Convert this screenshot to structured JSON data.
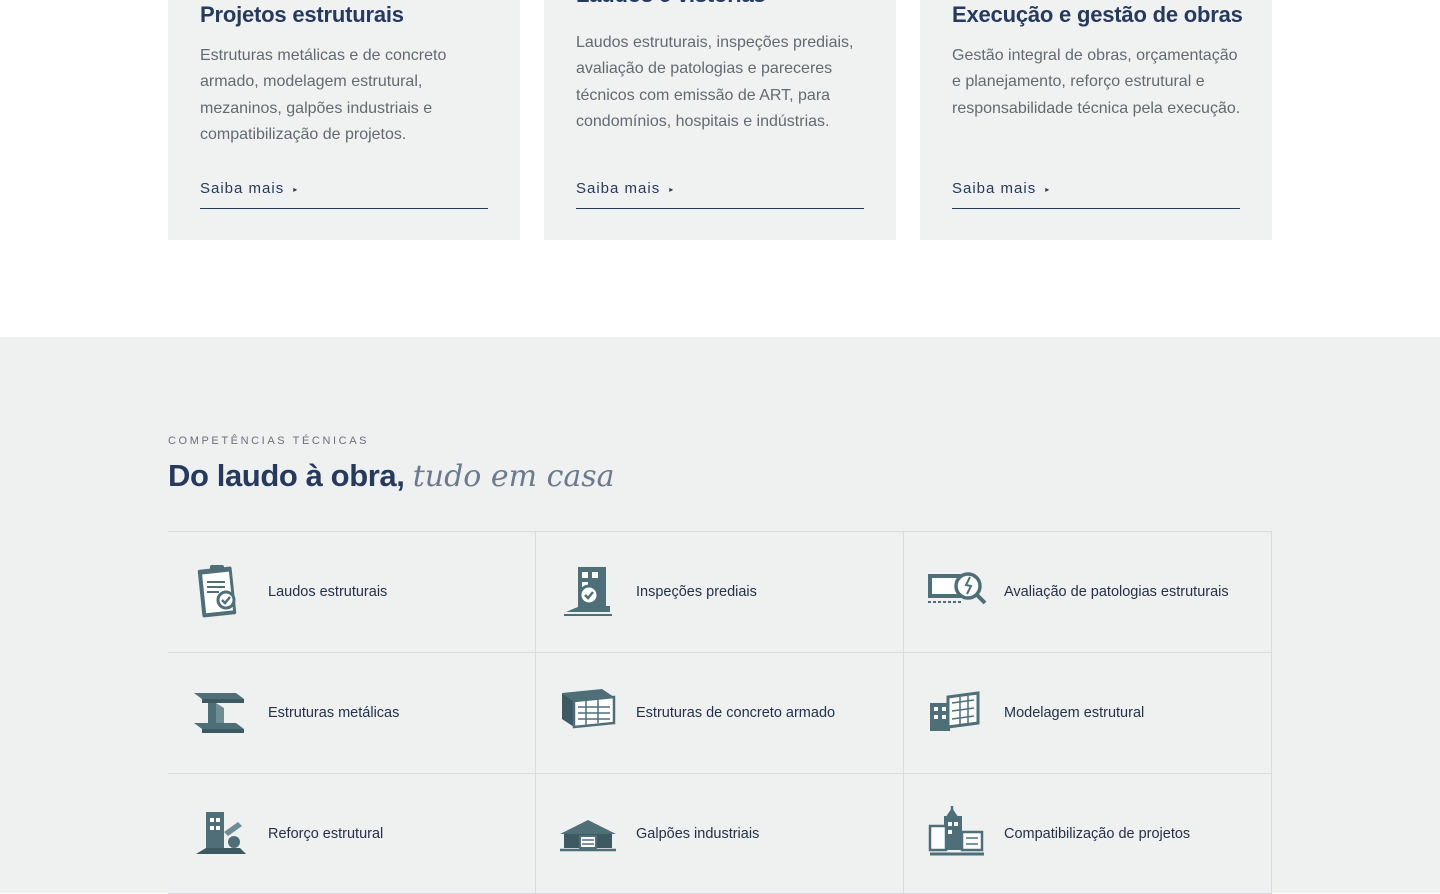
{
  "service_cards": [
    {
      "title": "Projetos estruturais",
      "description": "Estruturas metálicas e de concreto armado, modelagem estrutural, mezaninos, galpões industriais e compatibilização de projetos.",
      "link": "Saiba mais"
    },
    {
      "title": "Laudos e vistorias",
      "description": "Laudos estruturais, inspeções prediais, avaliação de patologias e pareceres técnicos com emissão de ART, para condomínios, hospitais e indústrias.",
      "link": "Saiba mais"
    },
    {
      "title": "Execução e gestão de obras",
      "description": "Gestão integral de obras, orçamentação e planejamento, reforço estrutural e responsabilidade técnica pela execução.",
      "link": "Saiba mais"
    }
  ],
  "link_arrow": "▸",
  "competencias": {
    "eyebrow": "COMPETÊNCIAS TÉCNICAS",
    "headline_bold": "Do laudo à obra,",
    "headline_italic": "tudo em casa",
    "items": [
      {
        "label": "Laudos estruturais",
        "icon": "clipboard-check-icon"
      },
      {
        "label": "Inspeções prediais",
        "icon": "building-inspection-icon"
      },
      {
        "label": "Avaliação de patologias estruturais",
        "icon": "magnifier-crack-icon"
      },
      {
        "label": "Estruturas metálicas",
        "icon": "steel-beam-icon"
      },
      {
        "label": "Estruturas de concreto armado",
        "icon": "concrete-rebar-icon"
      },
      {
        "label": "Modelagem estrutural",
        "icon": "structural-model-icon"
      },
      {
        "label": "Reforço estrutural",
        "icon": "reinforcement-icon"
      },
      {
        "label": "Galpões industriais",
        "icon": "warehouse-icon"
      },
      {
        "label": "Compatibilização de projetos",
        "icon": "project-compatibility-icon"
      }
    ]
  },
  "colors": {
    "navy": "#263a5e",
    "icon_teal": "#4f6f78",
    "muted_text": "#636a72",
    "section_bg": "#eff0f0"
  }
}
